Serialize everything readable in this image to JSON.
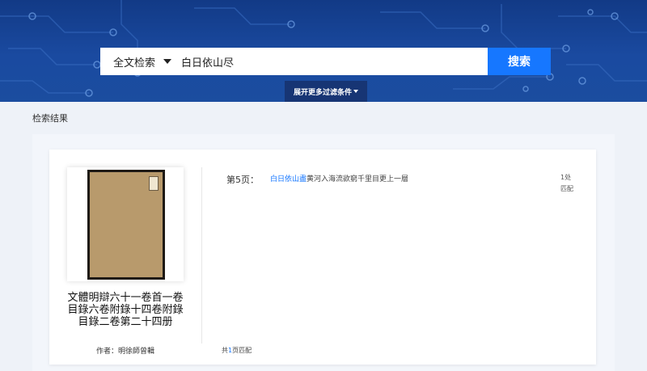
{
  "search": {
    "type_label": "全文检索",
    "query": "白日依山尽",
    "button_label": "搜索",
    "filter_toggle_label": "展开更多过滤条件"
  },
  "results": {
    "section_label": "检索结果",
    "items": [
      {
        "title": "文體明辯六十一卷首一卷目錄六卷附錄十四卷附錄目錄二卷第二十四册",
        "author_label": "作者：",
        "author": "明徐師曾輯",
        "page_label": "第5页：",
        "snippet_highlight": "白日依山盡",
        "snippet_rest": "黄河入海流欲窮千里目更上一層",
        "match_count": "1处",
        "match_unit": "匹配",
        "total_prefix": "共",
        "total_num": "1",
        "total_suffix": "页匹配"
      }
    ]
  },
  "colors": {
    "accent": "#1677ff",
    "banner": "#1a4aa0"
  }
}
